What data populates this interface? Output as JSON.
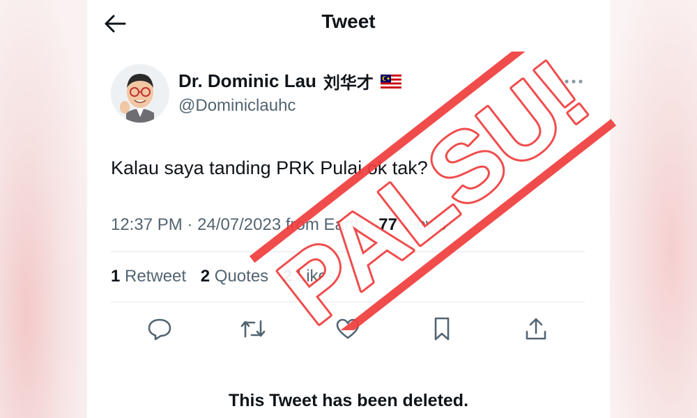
{
  "header": {
    "title": "Tweet"
  },
  "author": {
    "display_name": "Dr. Dominic Lau",
    "chinese_name": "刘华才",
    "flag": "malaysia-flag-icon",
    "handle": "@Dominiclauhc"
  },
  "tweet": {
    "text": "Kalau saya tanding PRK Pulai ok tak?",
    "time": "12:37 PM",
    "separator": "·",
    "date": "24/07/2023",
    "source": "from Earth",
    "views_count": "77",
    "views_label": "Views"
  },
  "stats": {
    "retweets_count": "1",
    "retweets_label": "Retweet",
    "quotes_count": "2",
    "quotes_label": "Quotes",
    "likes_count": "2",
    "likes_label": "Likes"
  },
  "actions": [
    "reply-icon",
    "retweet-icon",
    "like-icon",
    "bookmark-icon",
    "share-icon"
  ],
  "deleted_notice": "This Tweet has been deleted.",
  "stamp": {
    "text": "PALSU!",
    "color": "#ef3f3f"
  },
  "colors": {
    "text_primary": "#0f1419",
    "text_secondary": "#536471",
    "divider": "#e1e6ea"
  }
}
